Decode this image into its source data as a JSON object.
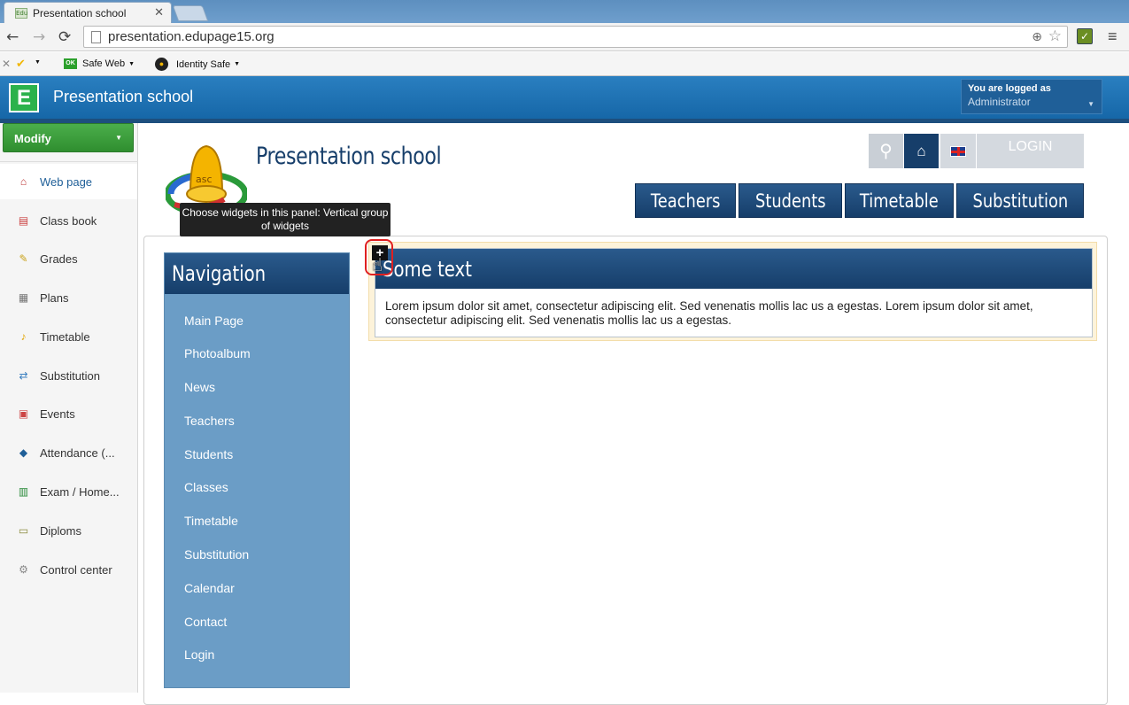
{
  "browser": {
    "tab_title": "Presentation school",
    "favicon_text": "Edu",
    "url": "presentation.edupage15.org",
    "bookmarks": [
      {
        "label": "Safe Web",
        "badge": "OK"
      },
      {
        "label": "Identity Safe"
      }
    ]
  },
  "app": {
    "title": "Presentation school",
    "logo_letter": "E",
    "login_label": "You are logged as",
    "login_user": "Administrator"
  },
  "sidebar": {
    "modify_label": "Modify",
    "items": [
      {
        "label": "Web page",
        "icon": "house-icon"
      },
      {
        "label": "Class book",
        "icon": "book-icon"
      },
      {
        "label": "Grades",
        "icon": "grades-icon"
      },
      {
        "label": "Plans",
        "icon": "plans-icon"
      },
      {
        "label": "Timetable",
        "icon": "bell-icon"
      },
      {
        "label": "Substitution",
        "icon": "substitution-icon"
      },
      {
        "label": "Events",
        "icon": "calendar-icon"
      },
      {
        "label": "Attendance (...",
        "icon": "attendance-icon"
      },
      {
        "label": "Exam / Home...",
        "icon": "exam-icon"
      },
      {
        "label": "Diploms",
        "icon": "diploma-icon"
      },
      {
        "label": "Control center",
        "icon": "gear-icon"
      }
    ]
  },
  "page": {
    "school_name": "Presentation school",
    "top_login": "LOGIN",
    "tabs": [
      "Teachers",
      "Students",
      "Timetable",
      "Substitution"
    ],
    "tooltip": "Choose widgets in this panel: Vertical group of widgets",
    "navigation": {
      "title": "Navigation",
      "links": [
        "Main Page",
        "Photoalbum",
        "News",
        "Teachers",
        "Students",
        "Classes",
        "Timetable",
        "Substitution",
        "Calendar",
        "Contact",
        "Login"
      ]
    },
    "widget": {
      "title": "Some text",
      "body": "Lorem ipsum dolor sit amet, consectetur adipiscing elit. Sed venenatis mollis lac us a egestas. Lorem ipsum dolor sit amet, consectetur adipiscing elit. Sed venenatis mollis lac us a egestas."
    }
  },
  "colors": {
    "brand_blue": "#1667a8",
    "navy": "#163e6a",
    "nav_panel": "#6b9dc6",
    "modify_green": "#3a9e3a",
    "highlight_red": "#e02020"
  }
}
